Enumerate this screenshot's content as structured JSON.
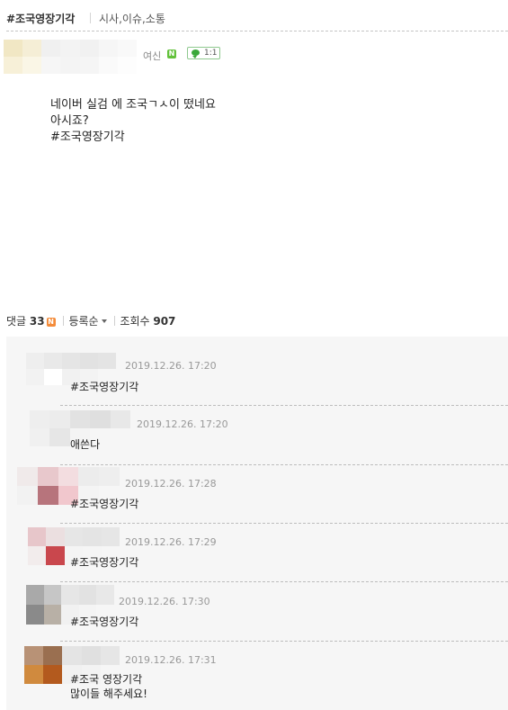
{
  "header": {
    "title": "#조국영장기각",
    "category": "시사,이슈,소통"
  },
  "author": {
    "name": "여신",
    "badge": "N",
    "chat_label": "1:1"
  },
  "post": {
    "lines": [
      "네이버 실검 에 조국ㄱㅅ이 떴네요",
      "아시죠?",
      "#조국영장기각"
    ]
  },
  "comment_bar": {
    "label": "댓글",
    "count": "33",
    "new_badge": "N",
    "sort_label": "등록순",
    "views_label": "조회수",
    "views": "907"
  },
  "comments": [
    {
      "date": "2019.12.26. 17:20",
      "lines": [
        "#조국영장기각"
      ]
    },
    {
      "date": "2019.12.26. 17:20",
      "lines": [
        "애쓴다"
      ]
    },
    {
      "date": "2019.12.26. 17:28",
      "lines": [
        "#조국영장기각"
      ]
    },
    {
      "date": "2019.12.26. 17:29",
      "lines": [
        "#조국영장기각"
      ]
    },
    {
      "date": "2019.12.26. 17:30",
      "lines": [
        "#조국영장기각"
      ]
    },
    {
      "date": "2019.12.26. 17:31",
      "lines": [
        "#조국 영장기각",
        "많이들 해주세요!"
      ]
    }
  ],
  "colors": {
    "chat_green": "#3aa83a",
    "new_badge": "#f48c3b",
    "author_badge": "#62c13b",
    "date_gray": "#999999"
  }
}
